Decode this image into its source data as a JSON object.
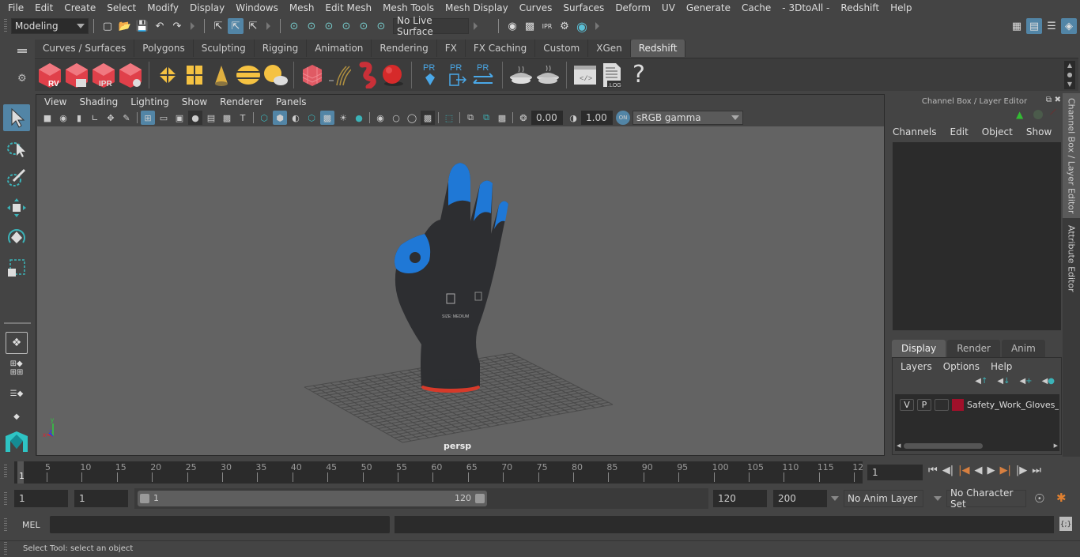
{
  "menubar": {
    "items": [
      "File",
      "Edit",
      "Create",
      "Select",
      "Modify",
      "Display",
      "Windows",
      "Mesh",
      "Edit Mesh",
      "Mesh Tools",
      "Mesh Display",
      "Curves",
      "Surfaces",
      "Deform",
      "UV",
      "Generate",
      "Cache",
      "- 3DtoAll -",
      "Redshift",
      "Help"
    ]
  },
  "statusline": {
    "mode": "Modeling",
    "live_surface": "No Live Surface"
  },
  "shelf": {
    "tabs": [
      "Curves / Surfaces",
      "Polygons",
      "Sculpting",
      "Rigging",
      "Animation",
      "Rendering",
      "FX",
      "FX Caching",
      "Custom",
      "XGen",
      "Redshift"
    ],
    "active_tab": "Redshift",
    "icons": [
      {
        "name": "redshift-render-view-icon",
        "label": "RV"
      },
      {
        "name": "redshift-batch-render-icon",
        "label": ""
      },
      {
        "name": "redshift-ipr-icon",
        "label": "IPR"
      },
      {
        "name": "redshift-settings-icon",
        "label": ""
      },
      {
        "name": "redshift-light-icon-1"
      },
      {
        "name": "redshift-light-icon-2"
      },
      {
        "name": "redshift-light-icon-3"
      },
      {
        "name": "redshift-dome-light-icon"
      },
      {
        "name": "redshift-sun-sky-icon"
      },
      {
        "name": "redshift-proxy-icon"
      },
      {
        "name": "redshift-hair-icon"
      },
      {
        "name": "redshift-volume-icon"
      },
      {
        "name": "redshift-material-icon"
      },
      {
        "name": "pr-mesh-icon",
        "label": "PR"
      },
      {
        "name": "pr-export-icon",
        "label": "PR"
      },
      {
        "name": "pr-swap-icon",
        "label": "PR"
      },
      {
        "name": "baking-icon-1"
      },
      {
        "name": "baking-icon-2"
      },
      {
        "name": "script-editor-icon"
      },
      {
        "name": "log-icon",
        "label": ".LOG"
      },
      {
        "name": "help-icon",
        "label": "?"
      }
    ]
  },
  "viewport": {
    "menu": [
      "View",
      "Shading",
      "Lighting",
      "Show",
      "Renderer",
      "Panels"
    ],
    "exposure": "0.00",
    "gamma": "1.00",
    "color_space": "sRGB gamma",
    "camera": "persp",
    "model_colors": {
      "glove": "#2a2b2e",
      "coating": "#1f78d6",
      "cuff": "#d63a2a"
    }
  },
  "channel_box": {
    "title": "Channel Box / Layer Editor",
    "menu": [
      "Channels",
      "Edit",
      "Object",
      "Show"
    ],
    "layer_tabs": [
      "Display",
      "Render",
      "Anim"
    ],
    "active_layer_tab": "Display",
    "layer_menu": [
      "Layers",
      "Options",
      "Help"
    ],
    "layers": [
      {
        "v": "V",
        "p": "P",
        "color": "#a0102a",
        "name": "Safety_Work_Gloves_C"
      }
    ]
  },
  "side_tabs": [
    "Channel Box / Layer Editor",
    "Attribute Editor"
  ],
  "timeline": {
    "ticks": [
      "5",
      "10",
      "15",
      "20",
      "25",
      "30",
      "35",
      "40",
      "45",
      "50",
      "55",
      "60",
      "65",
      "70",
      "75",
      "80",
      "85",
      "90",
      "95",
      "100",
      "105",
      "110",
      "115",
      "12"
    ],
    "current_frame_marker": "1",
    "current_frame": "1"
  },
  "range": {
    "start": "1",
    "playback_start": "1",
    "slider_min": "1",
    "slider_max": "120",
    "playback_end": "120",
    "end": "200",
    "anim_layer": "No Anim Layer",
    "character_set": "No Character Set"
  },
  "cmdline": {
    "label": "MEL"
  },
  "helpline": {
    "text": "Select Tool: select an object"
  }
}
